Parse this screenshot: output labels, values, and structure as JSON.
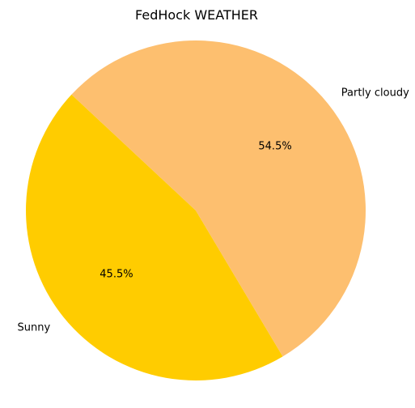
{
  "chart_data": {
    "type": "pie",
    "title": "FedHock WEATHER",
    "slices": [
      {
        "label": "Sunny",
        "value": 45.5,
        "pct_label": "45.5%",
        "color": "#ffcc00"
      },
      {
        "label": "Partly cloudy",
        "value": 54.5,
        "pct_label": "54.5%",
        "color": "#fdbf6f"
      }
    ],
    "legend": "none"
  }
}
